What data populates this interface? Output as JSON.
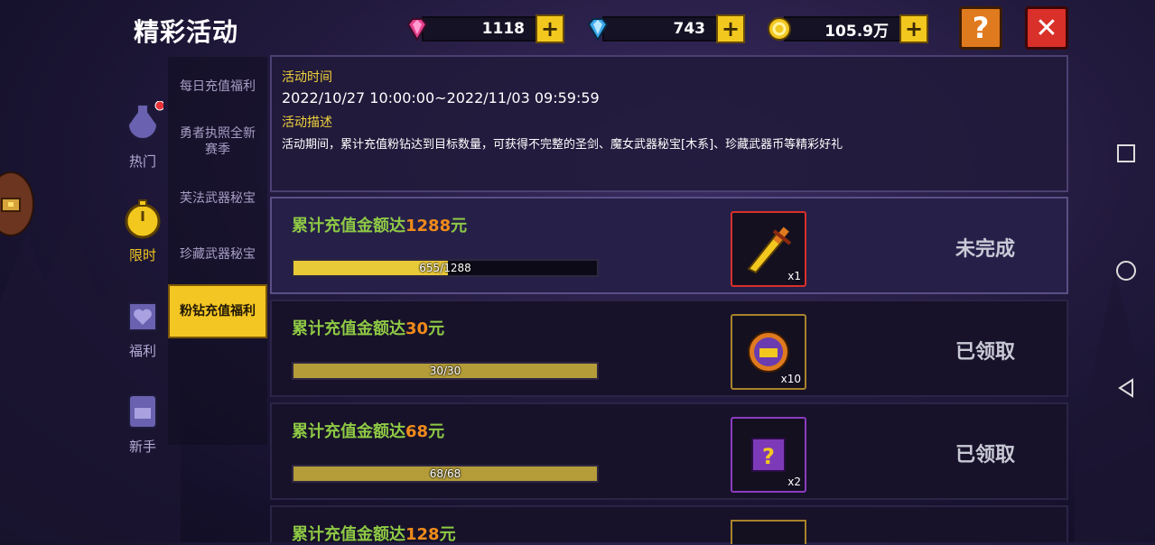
{
  "header": {
    "title": "精彩活动"
  },
  "currencies": [
    {
      "name": "pink-gem",
      "value": "1118",
      "color": "#e5408e"
    },
    {
      "name": "blue-gem",
      "value": "743",
      "color": "#3aa7e8"
    },
    {
      "name": "gold-coin",
      "value": "105.9万",
      "color": "#f2c81f"
    }
  ],
  "buttons": {
    "plus": "+",
    "help": "?",
    "close": "✕"
  },
  "categories": [
    {
      "key": "hot",
      "label": "热门",
      "icon": "potion-icon",
      "badge": true
    },
    {
      "key": "limited",
      "label": "限时",
      "icon": "stopwatch-icon",
      "active": true
    },
    {
      "key": "welfare",
      "label": "福利",
      "icon": "heart-bag-icon"
    },
    {
      "key": "newbie",
      "label": "新手",
      "icon": "backpack-icon"
    }
  ],
  "sub_tabs": [
    {
      "label": "每日充值福利"
    },
    {
      "label": "勇者执照全新赛季"
    },
    {
      "label": "芙法武器秘宝"
    },
    {
      "label": "珍藏武器秘宝"
    },
    {
      "label": "粉钻充值福利",
      "active": true
    }
  ],
  "info": {
    "time_label": "活动时间",
    "time_value": "2022/10/27 10:00:00~2022/11/03 09:59:59",
    "desc_label": "活动描述",
    "desc_value": "活动期间，累计充值粉钻达到目标数量，可获得不完整的圣剑、魔女武器秘宝[木系]、珍藏武器币等精彩好礼"
  },
  "rewards": [
    {
      "prefix": "累计充值金额达",
      "amount": "1288",
      "suffix": "元",
      "progress_text": "655/1288",
      "progress": 0.5085,
      "item": "sword-icon",
      "qty": "x1",
      "status": "未完成",
      "border": "#d9302a"
    },
    {
      "prefix": "累计充值金额达",
      "amount": "30",
      "suffix": "元",
      "progress_text": "30/30",
      "progress": 1,
      "item": "chest-icon",
      "qty": "x10",
      "status": "已领取",
      "border": "#a8832a"
    },
    {
      "prefix": "累计充值金额达",
      "amount": "68",
      "suffix": "元",
      "progress_text": "68/68",
      "progress": 1,
      "item": "mystery-box-icon",
      "qty": "x2",
      "status": "已领取",
      "border": "#8a3cbf"
    },
    {
      "prefix": "累计充值金额达",
      "amount": "128",
      "suffix": "元"
    }
  ]
}
